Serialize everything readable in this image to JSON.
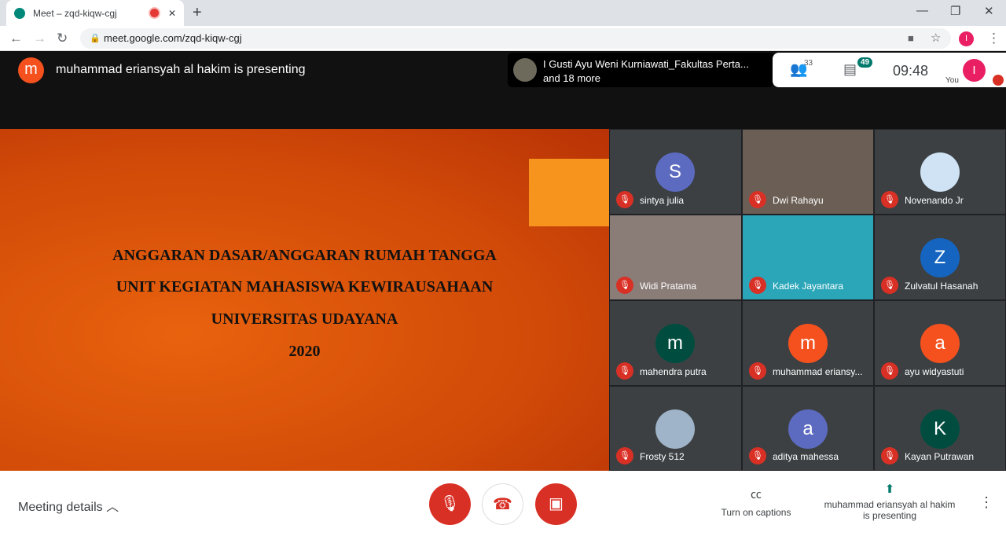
{
  "browser": {
    "tab_title": "Meet – zqd-kiqw-cgj",
    "url": "meet.google.com/zqd-kiqw-cgj",
    "profile_initial": "I"
  },
  "header": {
    "presenter_initial": "m",
    "presenting_text": "muhammad eriansyah al hakim is presenting",
    "others_line1": "I Gusti Ayu Weni Kurniawati_Fakultas Perta...",
    "others_line2": "and 18 more",
    "participants_count": "33",
    "chat_count": "49",
    "time": "09:48",
    "you_label": "You",
    "you_initial": "I"
  },
  "slide": {
    "lines": [
      "ANGGARAN DASAR/ANGGARAN RUMAH TANGGA",
      "UNIT KEGIATAN MAHASISWA KEWIRAUSAHAAN",
      "UNIVERSITAS UDAYANA",
      "2020"
    ]
  },
  "tiles": [
    {
      "name": "sintya julia",
      "initial": "S",
      "color": "#5c6bc0",
      "type": "avatar"
    },
    {
      "name": "Dwi Rahayu",
      "initial": "",
      "color": "#6b5f55",
      "type": "video"
    },
    {
      "name": "Novenando Jr",
      "initial": "",
      "color": "#cfe3f5",
      "type": "image"
    },
    {
      "name": "Widi Pratama",
      "initial": "",
      "color": "#8a7d78",
      "type": "video"
    },
    {
      "name": "Kadek Jayantara",
      "initial": "",
      "color": "#2aa6b8",
      "type": "video"
    },
    {
      "name": "Zulvatul Hasanah",
      "initial": "Z",
      "color": "#1565c0",
      "type": "avatar"
    },
    {
      "name": "mahendra putra",
      "initial": "m",
      "color": "#004d40",
      "type": "avatar"
    },
    {
      "name": "muhammad eriansy...",
      "initial": "m",
      "color": "#f4511e",
      "type": "avatar"
    },
    {
      "name": "ayu widyastuti",
      "initial": "a",
      "color": "#f4511e",
      "type": "avatar"
    },
    {
      "name": "Frosty 512",
      "initial": "",
      "color": "#9fb4c8",
      "type": "image"
    },
    {
      "name": "aditya mahessa",
      "initial": "a",
      "color": "#5c6bc0",
      "type": "avatar"
    },
    {
      "name": "Kayan Putrawan",
      "initial": "K",
      "color": "#004d40",
      "type": "avatar"
    }
  ],
  "footer": {
    "meeting_details": "Meeting details",
    "captions": "Turn on captions",
    "presenting_line1": "muhammad eriansyah al hakim",
    "presenting_line2": "is presenting"
  }
}
